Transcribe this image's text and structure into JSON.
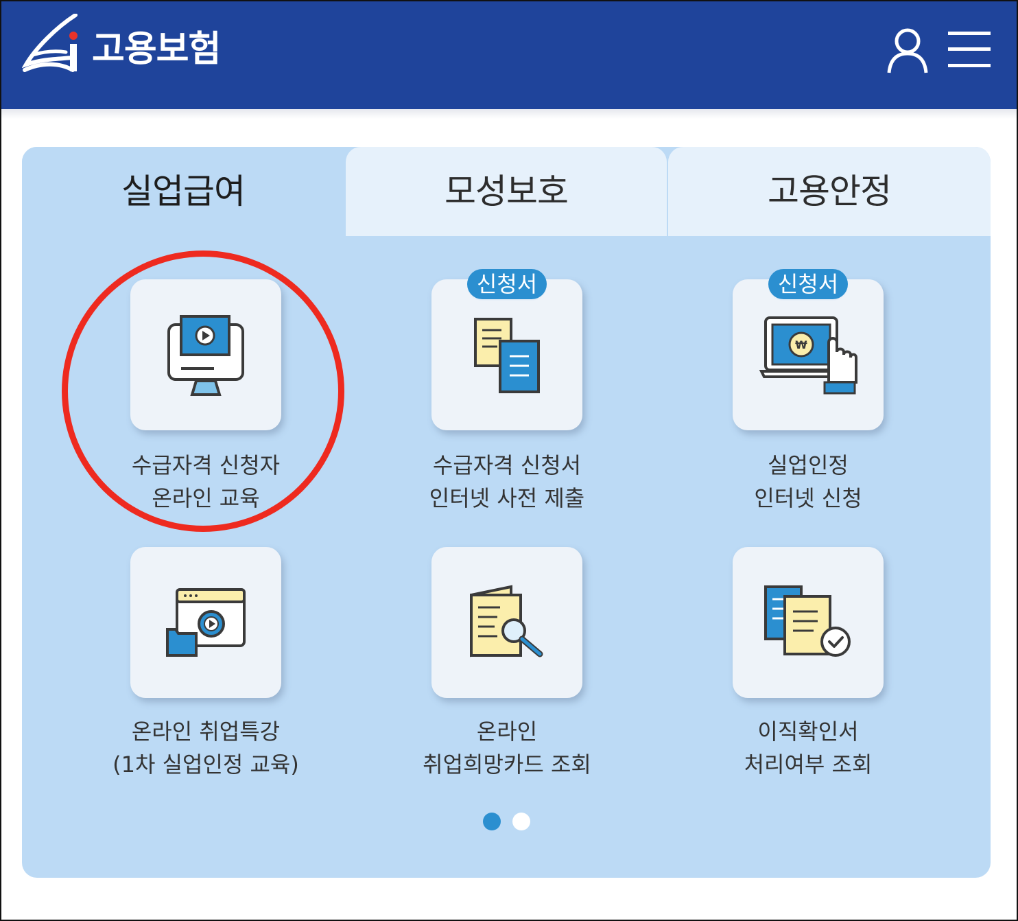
{
  "header": {
    "brand_name": "고용보험",
    "colors": {
      "background": "#1f449b",
      "text": "#ffffff"
    },
    "icons": [
      "ei-logo-icon",
      "user-icon",
      "hamburger-menu-icon"
    ]
  },
  "tabs": [
    {
      "label": "실업급여",
      "active": true
    },
    {
      "label": "모성보호",
      "active": false
    },
    {
      "label": "고용안정",
      "active": false
    }
  ],
  "tiles": [
    {
      "icon": "monitor-play-icon",
      "badge": "",
      "line1": "수급자격 신청자",
      "line2": "온라인 교육",
      "highlighted": true
    },
    {
      "icon": "documents-icon",
      "badge": "신청서",
      "line1": "수급자격 신청서",
      "line2": "인터넷 사전 제출"
    },
    {
      "icon": "laptop-won-hand-icon",
      "badge": "신청서",
      "line1": "실업인정",
      "line2": "인터넷 신청"
    },
    {
      "icon": "browser-video-folder-icon",
      "badge": "",
      "line1": "온라인 취업특강",
      "line2": "(1차 실업인정 교육)"
    },
    {
      "icon": "document-search-icon",
      "badge": "",
      "line1": "온라인",
      "line2": "취업희망카드 조회"
    },
    {
      "icon": "documents-check-icon",
      "badge": "",
      "line1": "이직확인서",
      "line2": "처리여부 조회"
    }
  ],
  "pagination": {
    "current": 1,
    "total": 2
  },
  "colors": {
    "panel": "#bcdaf5",
    "accent": "#2b8fd0",
    "highlight_circle": "#ee2a1f"
  }
}
